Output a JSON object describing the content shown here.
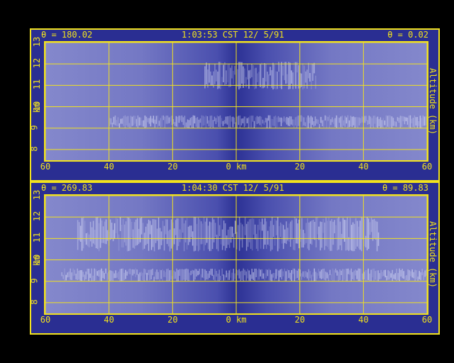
{
  "panels": [
    {
      "header_left": "θ = 180.02",
      "header_center": "1:03:53 CST 12/ 5/91",
      "header_right": "θ = 0.02",
      "yunit": "km",
      "right_label": "Altitude (km)"
    },
    {
      "header_left": "θ = 269.83",
      "header_center": "1:04:30 CST 12/ 5/91",
      "header_right": "θ = 89.83",
      "yunit": "km",
      "right_label": "Altitude (km)"
    }
  ],
  "colors": {
    "background": "#000000",
    "panel": "#2a2e92",
    "grid": "#f2e21e",
    "cloud": "#e8ecff"
  },
  "chart_data": [
    {
      "type": "heatmap",
      "title": "",
      "xlabel": "km",
      "ylabel": "Altitude (km)",
      "xlim": [
        -60,
        60
      ],
      "ylim": [
        7.5,
        13
      ],
      "x_tick_labels": [
        "60",
        "40",
        "20",
        "0 km",
        "20",
        "40",
        "60"
      ],
      "x_ticks": [
        -60,
        -40,
        -20,
        0,
        20,
        40,
        60
      ],
      "y_ticks": [
        8,
        9,
        10,
        11,
        12,
        13
      ],
      "grid": true,
      "cloud_layers": [
        {
          "x_start": -40,
          "x_end": 60,
          "base": 9.0,
          "top": 9.6
        },
        {
          "x_start": -10,
          "x_end": 25,
          "base": 10.8,
          "top": 12.1
        }
      ]
    },
    {
      "type": "heatmap",
      "title": "",
      "xlabel": "km",
      "ylabel": "Altitude (km)",
      "xlim": [
        -60,
        60
      ],
      "ylim": [
        7.5,
        13
      ],
      "x_tick_labels": [
        "60",
        "40",
        "20",
        "0 km",
        "20",
        "40",
        "60"
      ],
      "x_ticks": [
        -60,
        -40,
        -20,
        0,
        20,
        40,
        60
      ],
      "y_ticks": [
        8,
        9,
        10,
        11,
        12,
        13
      ],
      "grid": true,
      "cloud_layers": [
        {
          "x_start": -55,
          "x_end": 60,
          "base": 9.0,
          "top": 9.6
        },
        {
          "x_start": -50,
          "x_end": 45,
          "base": 10.4,
          "top": 12.0
        }
      ]
    }
  ]
}
